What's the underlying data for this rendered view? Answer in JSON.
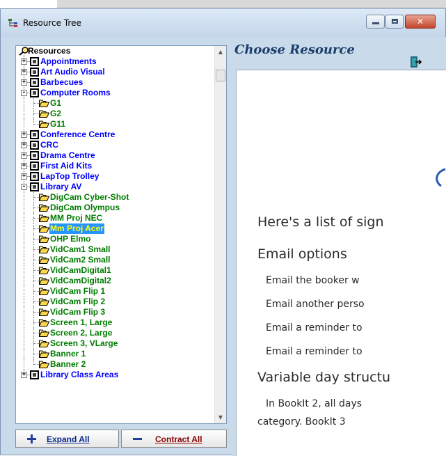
{
  "window": {
    "title": "Resource Tree"
  },
  "tree": {
    "root": "Resources",
    "rows": [
      {
        "type": "cat",
        "label": "Appointments",
        "state": "+"
      },
      {
        "type": "cat",
        "label": "Art Audio Visual",
        "state": "+"
      },
      {
        "type": "cat",
        "label": "Barbecues",
        "state": "+"
      },
      {
        "type": "cat",
        "label": "Computer Rooms",
        "state": "-"
      },
      {
        "type": "item",
        "label": "G1"
      },
      {
        "type": "item",
        "label": "G2"
      },
      {
        "type": "item",
        "label": "G11",
        "last": true
      },
      {
        "type": "cat",
        "label": "Conference Centre",
        "state": "+"
      },
      {
        "type": "cat",
        "label": "CRC",
        "state": "+"
      },
      {
        "type": "cat",
        "label": "Drama Centre",
        "state": "+"
      },
      {
        "type": "cat",
        "label": "First Aid Kits",
        "state": "+"
      },
      {
        "type": "cat",
        "label": "LapTop Trolley",
        "state": "+"
      },
      {
        "type": "cat",
        "label": "Library AV",
        "state": "-"
      },
      {
        "type": "item",
        "label": "DigCam Cyber-Shot"
      },
      {
        "type": "item",
        "label": "DigCam Olympus"
      },
      {
        "type": "item",
        "label": "MM Proj NEC"
      },
      {
        "type": "item",
        "label": "Mm Proj Acer",
        "selected": true
      },
      {
        "type": "item",
        "label": "OHP Elmo"
      },
      {
        "type": "item",
        "label": "VidCam1 Small"
      },
      {
        "type": "item",
        "label": "VidCam2 Small"
      },
      {
        "type": "item",
        "label": "VidCamDigital1"
      },
      {
        "type": "item",
        "label": "VidCamDigital2"
      },
      {
        "type": "item",
        "label": "VidCam Flip 1"
      },
      {
        "type": "item",
        "label": "VidCam Flip 2"
      },
      {
        "type": "item",
        "label": "VidCam Flip 3"
      },
      {
        "type": "item",
        "label": "Screen 1, Large"
      },
      {
        "type": "item",
        "label": "Screen 2, Large"
      },
      {
        "type": "item",
        "label": "Screen 3, VLarge"
      },
      {
        "type": "item",
        "label": "Banner 1"
      },
      {
        "type": "item",
        "label": "Banner 2",
        "last": true
      },
      {
        "type": "cat",
        "label": "Library Class Areas",
        "state": "+"
      }
    ]
  },
  "buttons": {
    "expand": "Expand All",
    "contract": "Contract All"
  },
  "right_panel": {
    "heading": "Choose Resource",
    "intro": "Here's a list of sign",
    "section1": "Email options",
    "options": [
      "Email the booker w",
      "Email another perso",
      "Email a reminder to",
      "Email a reminder to"
    ],
    "section2": "Variable day structu",
    "para_line1": "In BookIt 2, all days",
    "para_line2": "category.  BookIt 3"
  },
  "colors": {
    "category_text": "#0000ff",
    "item_text": "#007c00",
    "selected_bg": "#2894ff",
    "selected_text": "#ffff00",
    "window_bg": "#c9daea"
  }
}
